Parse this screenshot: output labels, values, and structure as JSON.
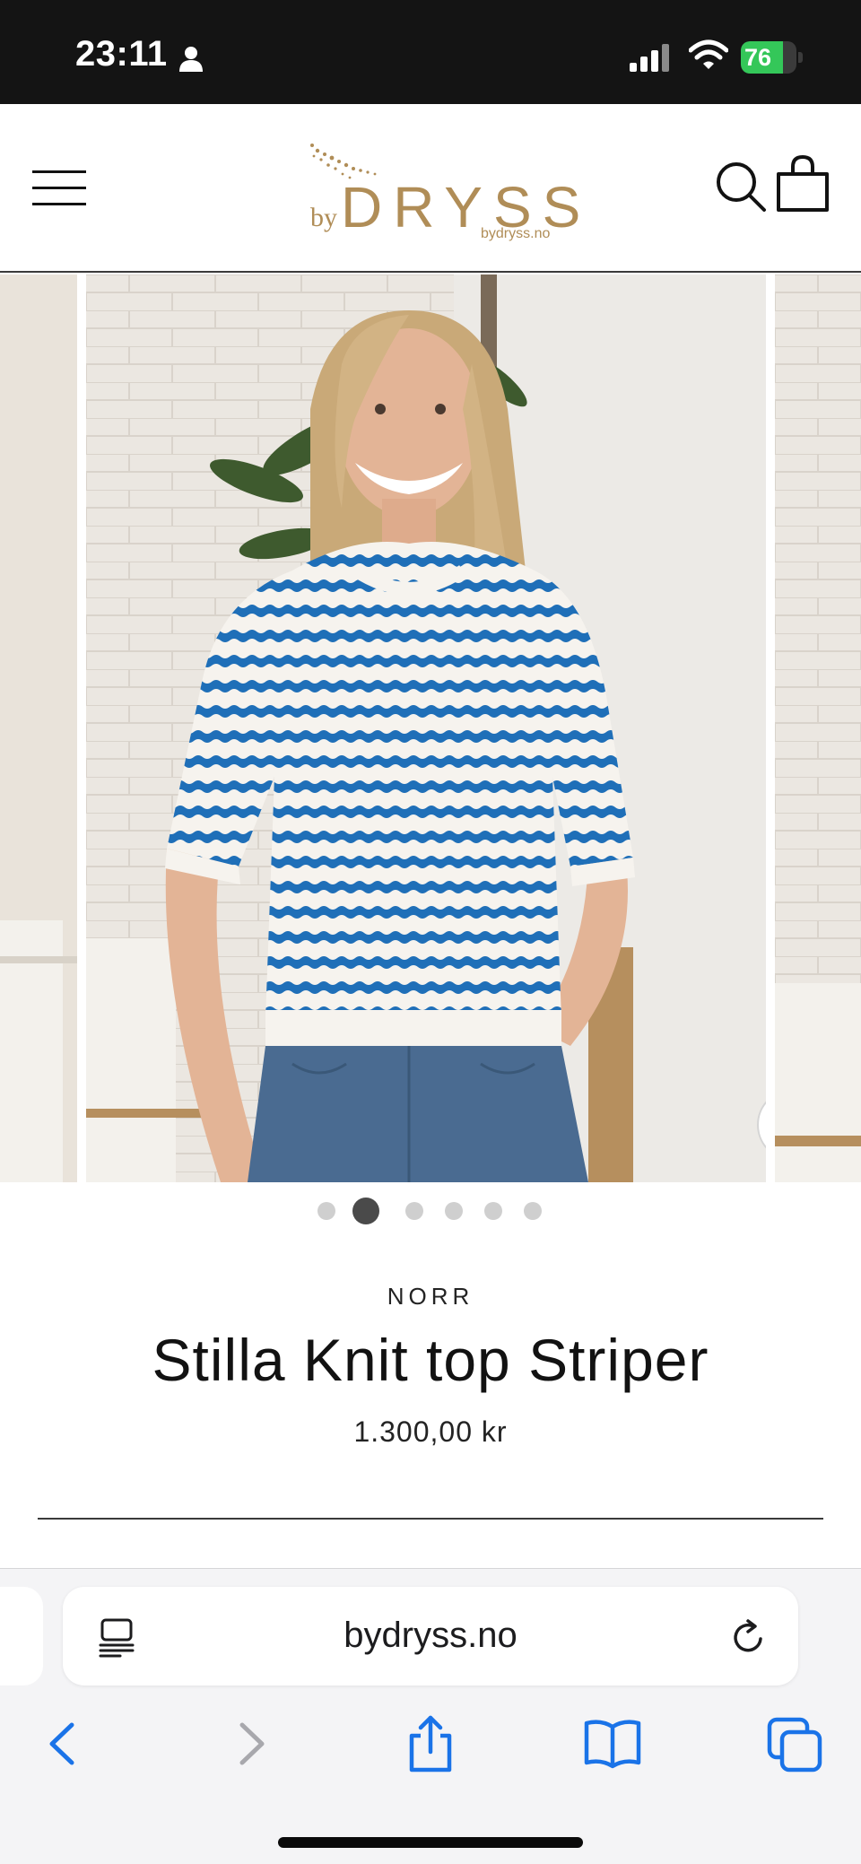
{
  "status_bar": {
    "time": "23:11",
    "battery": "76",
    "battery_level": 0.76,
    "icons": [
      "person-icon",
      "signal-icon",
      "wifi-icon",
      "battery-icon"
    ]
  },
  "header": {
    "logo_prefix": "by",
    "logo_main": "DRYSS",
    "logo_domain": "bydryss.no",
    "brand_color": "#b08d57",
    "icons": [
      "menu-icon",
      "search-icon",
      "cart-icon"
    ]
  },
  "gallery": {
    "slide_count": 6,
    "active_index": 1,
    "icons": [
      "zoom-icon"
    ]
  },
  "product": {
    "vendor": "NORR",
    "title": "Stilla Knit top Striper",
    "price": "1.300,00 kr"
  },
  "browser": {
    "address": "bydryss.no",
    "accent": "#1a73e8",
    "icons": [
      "reader-icon",
      "reload-icon",
      "back-icon",
      "forward-icon",
      "share-icon",
      "bookmarks-icon",
      "tabs-icon"
    ]
  }
}
